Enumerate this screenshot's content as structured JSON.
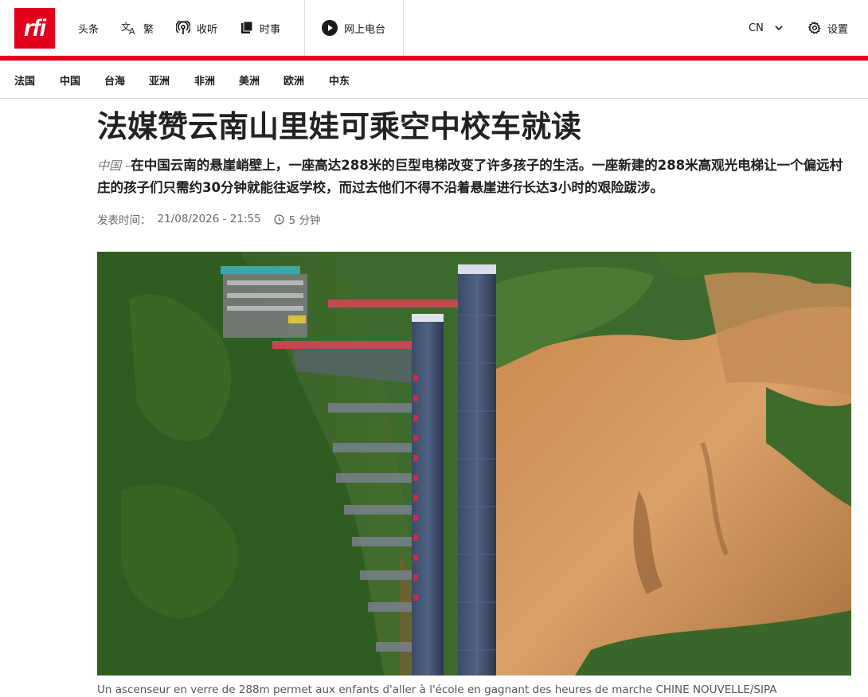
{
  "header": {
    "logo_text": "rfi",
    "nav": [
      {
        "label": "头条",
        "icon": "none"
      },
      {
        "label": "繁",
        "icon": "translate-icon"
      },
      {
        "label": "收听",
        "icon": "podcast-icon"
      },
      {
        "label": "时事",
        "icon": "document-icon"
      },
      {
        "label": "网上电台",
        "icon": "play-icon"
      }
    ],
    "language": "CN",
    "settings_label": "设置"
  },
  "regions": [
    "法国",
    "中国",
    "台海",
    "亚洲",
    "非洲",
    "美洲",
    "欧洲",
    "中东"
  ],
  "article": {
    "title": "法媒赞云南山里娃可乘空中校车就读",
    "kicker": "中国 –",
    "lede": "在中国云南的悬崖峭壁上，一座高达288米的巨型电梯改变了许多孩子的生活。一座新建的288米高观光电梯让一个偏远村庄的孩子们只需约30分钟就能往返学校，而过去他们不得不沿着悬崖进行长达3小时的艰险跋涉。",
    "published_label": "发表时间：",
    "published_date": "21/08/2026 - 21:55",
    "read_time": "5 分钟",
    "photo_caption": "Un ascenseur en verre de 288m permet aux enfants d'aller à l'école en gagnant des heures de marche CHINE NOUVELLE/SIPA"
  },
  "colors": {
    "brand_red": "#e3001b"
  }
}
